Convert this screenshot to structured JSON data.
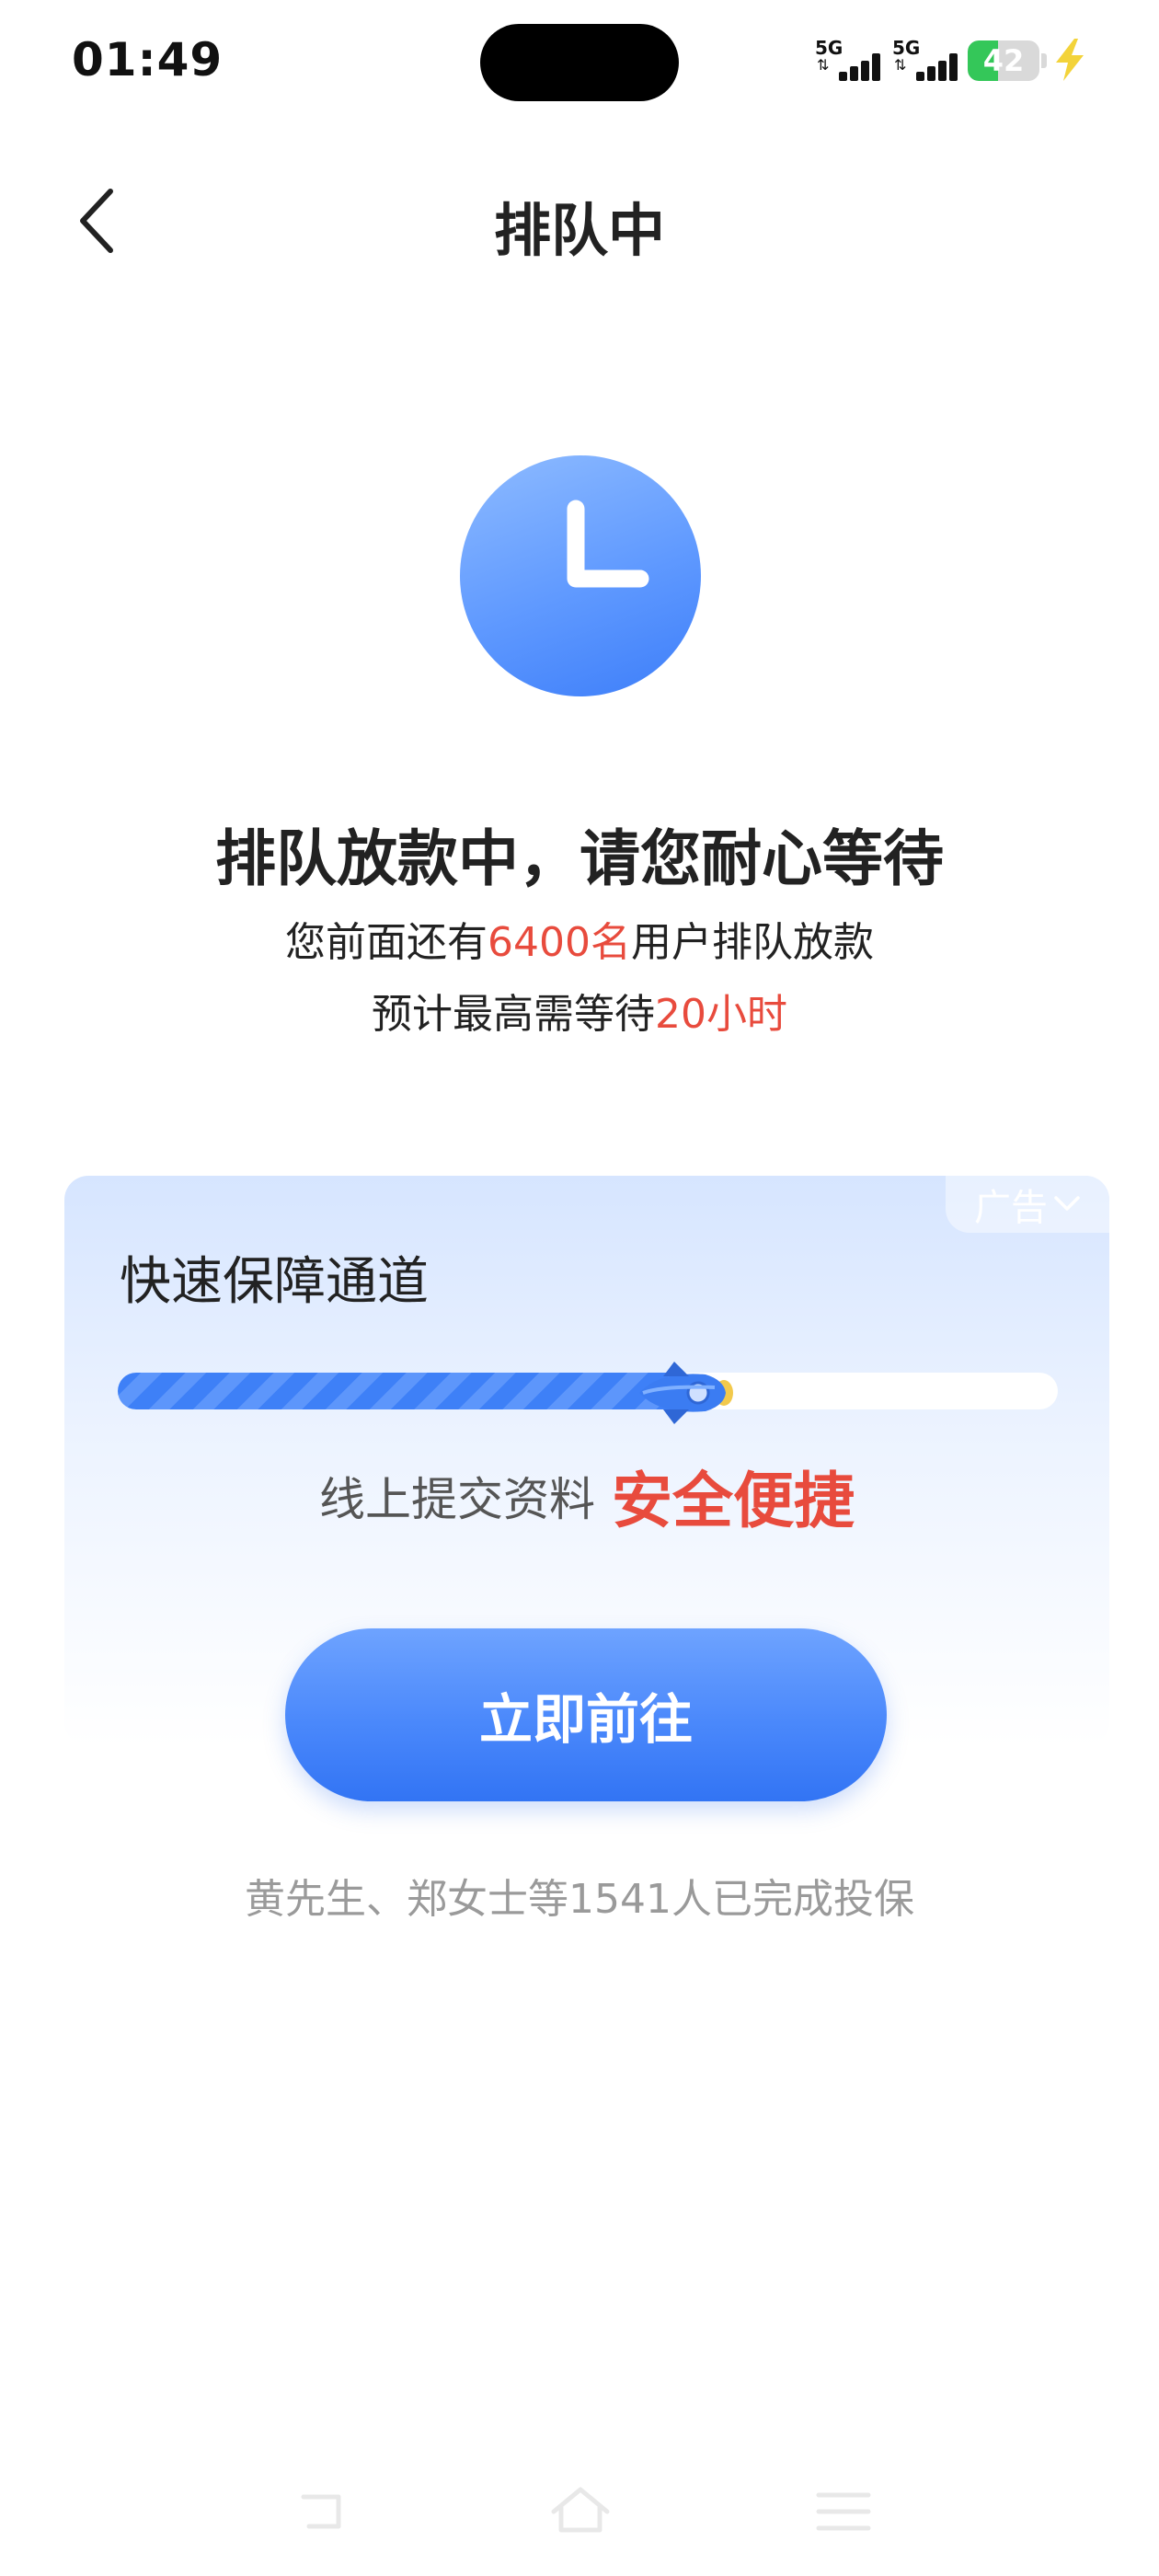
{
  "status_bar": {
    "time": "01:49",
    "sim1_label": "5G",
    "sim2_label": "5G",
    "battery_level": "42",
    "battery_fraction": 0.42
  },
  "header": {
    "title": "排队中"
  },
  "status": {
    "heading": "排队放款中，请您耐心等待",
    "queue_prefix": "您前面还有",
    "queue_count": "6400名",
    "queue_suffix": "用户排队放款",
    "wait_prefix": "预计最高需等待",
    "wait_time": "20小时"
  },
  "ad_card": {
    "ad_label": "广告",
    "title": "快速保障通道",
    "progress_fraction": 0.6,
    "promo_text": "线上提交资料",
    "promo_highlight": "安全便捷"
  },
  "cta": {
    "button_label": "立即前往"
  },
  "social_proof": {
    "text": "黄先生、郑女士等1541人已完成投保"
  },
  "colors": {
    "accent_blue": "#4a88fb",
    "highlight_red": "#e84b3d",
    "battery_green": "#34c759"
  },
  "icons": {
    "back": "chevron-left-icon",
    "clock": "clock-icon",
    "ad_toggle": "chevron-down-icon",
    "rocket": "rocket-icon",
    "nav_recent": "recent-apps-icon",
    "nav_home": "home-icon",
    "nav_menu": "menu-icon"
  }
}
